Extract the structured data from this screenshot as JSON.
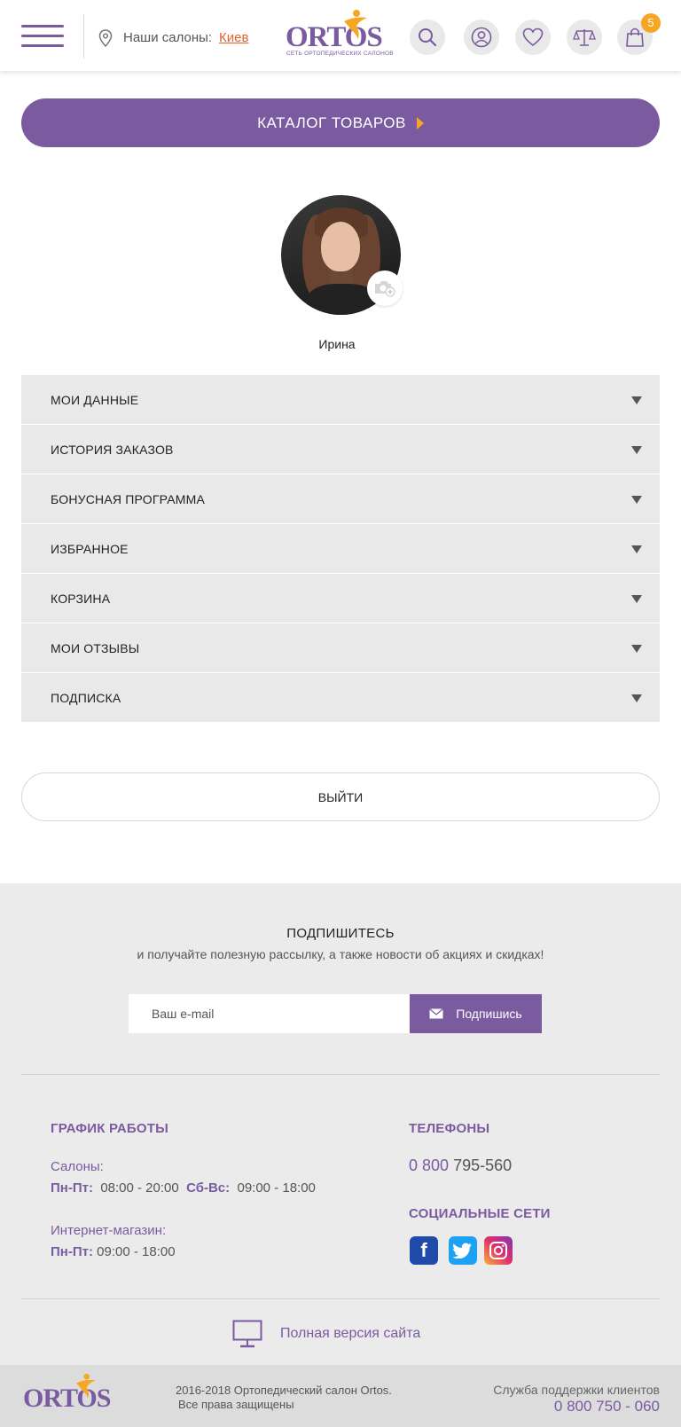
{
  "header": {
    "salons_label": "Наши салоны:",
    "city": "Киев",
    "logo_text": "ORTOS",
    "logo_subtitle": "СЕТЬ ОРТОПЕДИЧЕСКИХ САЛОНОВ",
    "cart_count": "5",
    "icons": [
      "menu-icon",
      "location-pin-icon",
      "search-icon",
      "user-icon",
      "heart-icon",
      "compare-scales-icon",
      "shopping-bag-icon"
    ]
  },
  "catalog": {
    "label": "КАТАЛОГ ТОВАРОВ"
  },
  "profile": {
    "name": "Ирина"
  },
  "menu": {
    "items": [
      {
        "label": "МОИ ДАННЫЕ"
      },
      {
        "label": "ИСТОРИЯ ЗАКАЗОВ"
      },
      {
        "label": "БОНУСНАЯ ПРОГРАММА"
      },
      {
        "label": "ИЗБРАННОЕ"
      },
      {
        "label": "КОРЗИНА"
      },
      {
        "label": "МОИ ОТЗЫВЫ"
      },
      {
        "label": "ПОДПИСКА"
      }
    ]
  },
  "logout": {
    "label": "ВЫЙТИ"
  },
  "subscribe": {
    "title": "ПОДПИШИТЕСЬ",
    "text": "и получайте полезную рассылку, а также новости об акциях и скидках!",
    "email_placeholder": "Ваш e-mail",
    "button": "Подпишись"
  },
  "schedule": {
    "title": "ГРАФИК РАБОТЫ",
    "salons_label": "Салоны:",
    "weekdays_label": "Пн-Пт:",
    "weekdays_hours": "08:00 - 20:00",
    "weekend_label": "Сб-Вс:",
    "weekend_hours": "09:00 - 18:00",
    "shop_label": "Интернет-магазин:",
    "shop_days_label": "Пн-Пт:",
    "shop_hours": "09:00 - 18:00"
  },
  "phones": {
    "title": "ТЕЛЕФОНЫ",
    "phone_prefix": "0 800",
    "phone_rest": "795-560"
  },
  "social": {
    "title": "СОЦИАЛЬНЫЕ СЕТИ",
    "fb_glyph": "f"
  },
  "full_version": {
    "label": "Полная версия сайта"
  },
  "bottom": {
    "copyright_line1": "2016-2018  Ортопедический салон Ortos.",
    "copyright_line2": "Все права защищены",
    "support_label": "Служба поддержки клиентов",
    "support_phone": "0 800 750 - 060"
  },
  "colors": {
    "brand": "#7a5ba0",
    "accent": "#f5a623",
    "link": "#e8622c"
  }
}
